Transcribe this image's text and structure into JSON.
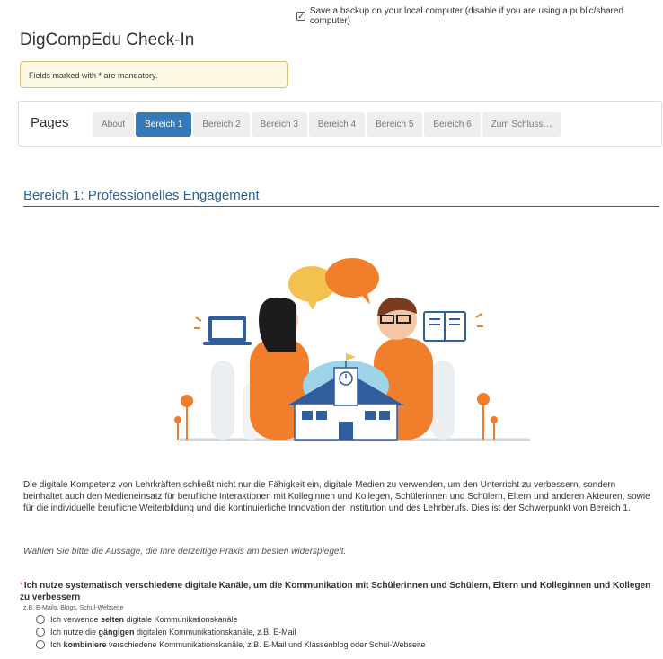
{
  "backup": {
    "label": "Save a backup on your local computer (disable if you are using a public/shared computer)",
    "checked": true
  },
  "title": "DigCompEdu Check-In",
  "mandatory_note": "Fields marked with * are mandatory.",
  "pages": {
    "label": "Pages",
    "tabs": [
      {
        "label": "About",
        "active": false
      },
      {
        "label": "Bereich 1",
        "active": true
      },
      {
        "label": "Bereich 2",
        "active": false
      },
      {
        "label": "Bereich 3",
        "active": false
      },
      {
        "label": "Bereich 4",
        "active": false
      },
      {
        "label": "Bereich 5",
        "active": false
      },
      {
        "label": "Bereich 6",
        "active": false
      },
      {
        "label": "Zum Schluss…",
        "active": false
      }
    ]
  },
  "section": {
    "title": "Bereich 1: Professionelles Engagement",
    "intro": "Die digitale Kompetenz von Lehrkräften schließt nicht nur die Fähigkeit ein, digitale Medien zu verwenden, um den Unterricht zu verbessern, sondern beinhaltet auch den Medieneinsatz für berufliche Interaktionen mit Kolleginnen und Kollegen, Schülerinnen und Schülern, Eltern und anderen Akteuren, sowie für die individuelle berufliche Weiterbildung und die kontinuierliche Innovation der Institution und des Lehrberufs. Dies ist der Schwerpunkt von Bereich 1.",
    "instruction": "Wählen Sie bitte die Aussage, die Ihre derzeitige Praxis am besten widerspiegelt."
  },
  "question": {
    "required_marker": "*",
    "text": "Ich nutze systematisch verschiedene digitale Kanäle, um die Kommunikation mit Schülerinnen und Schülern, Eltern und Kolleginnen und Kollegen zu verbessern",
    "hint": "z.B. E-Mails, Blogs, Schul-Webseite",
    "options": [
      {
        "pre": "Ich verwende ",
        "bold": "selten",
        "post": " digitale Kommunikationskanäle"
      },
      {
        "pre": "Ich nutze die ",
        "bold": "gängigen",
        "post": " digitalen Kommunikationskanäle, z.B. E-Mail"
      },
      {
        "pre": "Ich ",
        "bold": "kombiniere",
        "post": " verschiedene Kommunikationskanäle, z.B. E-Mail und Klassenblog oder Schul-Webseite"
      }
    ]
  },
  "colors": {
    "accent": "#337ab7",
    "section_title": "#2a6496",
    "warning_bg": "#fcf8e3",
    "illustration_orange": "#f07e2a",
    "illustration_yellow": "#f2c14e",
    "illustration_blue": "#2f5d9e"
  }
}
